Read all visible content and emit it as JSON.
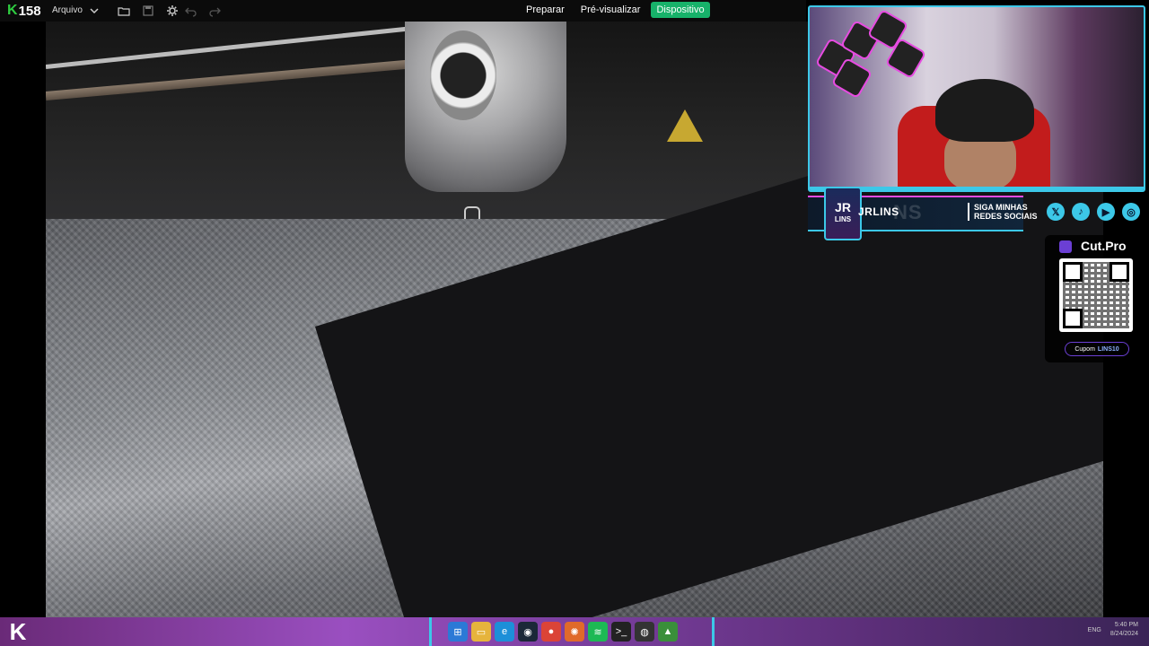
{
  "app": {
    "brand_letter": "K",
    "brand_number": "158",
    "menu_label": "Arquivo"
  },
  "toolbar": {
    "icons": [
      "chevron-down-icon",
      "folder-icon",
      "save-icon",
      "gear-icon",
      "undo-icon",
      "redo-icon"
    ]
  },
  "nav": {
    "tabs": [
      {
        "label": "Preparar",
        "active": false
      },
      {
        "label": "Pré-visualizar",
        "active": false
      },
      {
        "label": "Dispositivo",
        "active": true
      }
    ],
    "accent": "#17b26a"
  },
  "overlay": {
    "logo_line1": "JR",
    "logo_line2": "LINS",
    "name": "JRLINS",
    "ghost_name": "NS",
    "follow_line1": "SIGA MINHAS",
    "follow_line2": "REDES SOCIAIS",
    "socials": [
      "x-icon",
      "tiktok-icon",
      "youtube-icon",
      "instagram-icon"
    ],
    "accent_cyan": "#3cc8e8",
    "accent_pink": "#e64be0"
  },
  "sponsor": {
    "brand": "Cut.Pro",
    "coupon_label": "Cupom",
    "coupon_code": "LINS10"
  },
  "taskbar": {
    "corner_letter": "K",
    "apps": [
      "windows-icon",
      "file-explorer-icon",
      "edge-icon",
      "steam-icon",
      "chrome-icon",
      "app-icon",
      "spotify-icon",
      "terminal-icon",
      "obs-icon",
      "slicer-icon"
    ],
    "tray_lang": "ENG",
    "clock_time": "5:40 PM",
    "clock_date": "8/24/2024"
  }
}
